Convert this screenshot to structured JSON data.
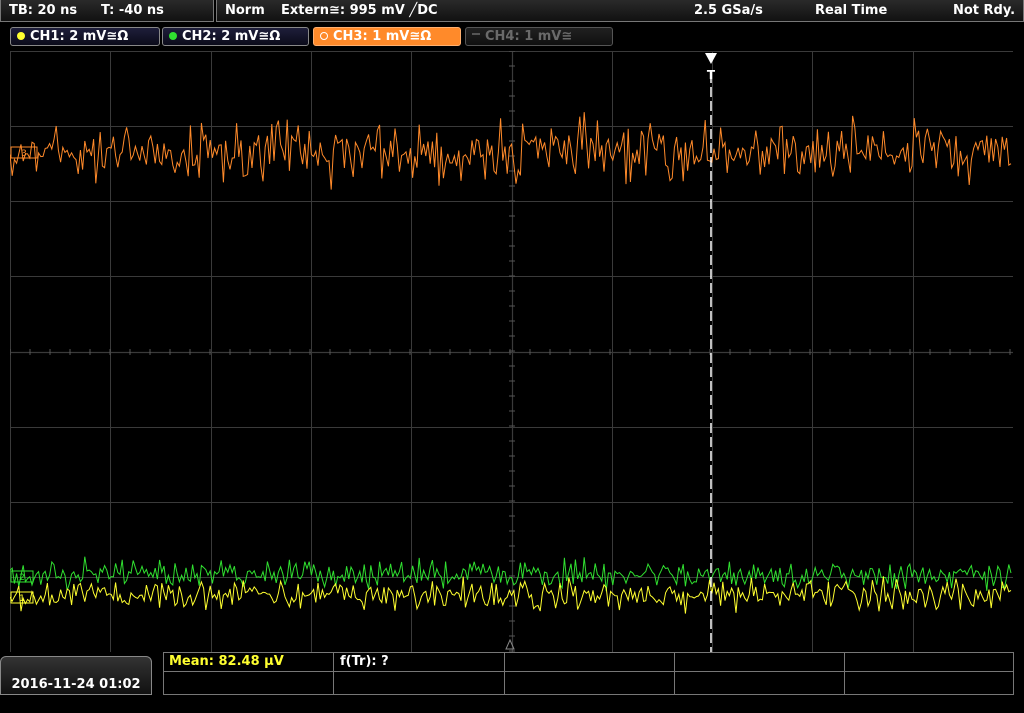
{
  "status": {
    "timebase": "TB: 20 ns",
    "trigger_time": "T: -40 ns",
    "mode": "Norm",
    "trigger_source": "Extern≅: 995 mV ╱DC",
    "sample_rate": "2.5 GSa/s",
    "acquisition": "Real Time",
    "state": "Not Rdy."
  },
  "channels": [
    {
      "label": "CH1: 2 mV≅Ω",
      "color": "#ffff30",
      "active": true
    },
    {
      "label": "CH2: 2 mV≅Ω",
      "color": "#30e030",
      "active": true
    },
    {
      "label": "CH3: 1 mV≅Ω",
      "color": "#ff8a2a",
      "active": true,
      "selected": true
    },
    {
      "label": "CH4: 1 mV≅",
      "color": "#666666",
      "active": false
    }
  ],
  "screen": {
    "trigger_marker": "T",
    "ch_markers": [
      "2",
      "1",
      "3"
    ]
  },
  "bottom": {
    "datetime": "2016-11-24 01:02",
    "mean": "Mean: 82.48 µV",
    "freq": "f(Tr): ?"
  },
  "colors": {
    "ch1": "#ffff30",
    "ch2": "#30e030",
    "ch3": "#ff8a2a",
    "grid": "#3a3a3a",
    "meas_text": "#ffff30"
  }
}
